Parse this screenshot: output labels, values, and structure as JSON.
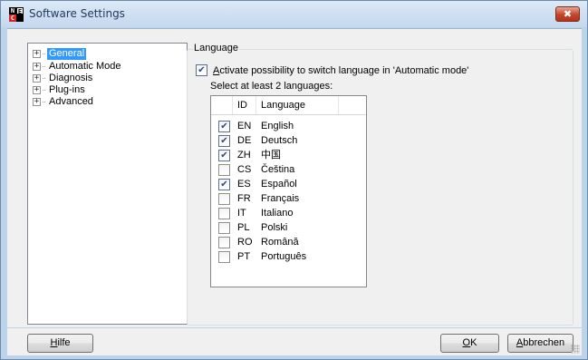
{
  "window": {
    "title": "Software Settings",
    "icon_letters": [
      "N",
      "E",
      "C",
      ""
    ],
    "close_glyph": "✖"
  },
  "tree": {
    "items": [
      {
        "label": "General",
        "selected": true
      },
      {
        "label": "Automatic Mode",
        "selected": false
      },
      {
        "label": "Diagnosis",
        "selected": false
      },
      {
        "label": "Plug-ins",
        "selected": false
      },
      {
        "label": "Advanced",
        "selected": false
      }
    ]
  },
  "language_group": {
    "title": "Language",
    "activate_label_prefix": "A",
    "activate_label_rest": "ctivate possibility to switch language in 'Automatic mode'",
    "activate_checked": true,
    "select_label": "Select at least 2 languages:",
    "columns": [
      "ID",
      "Language"
    ],
    "languages": [
      {
        "id": "EN",
        "name": "English",
        "checked": true
      },
      {
        "id": "DE",
        "name": "Deutsch",
        "checked": true
      },
      {
        "id": "ZH",
        "name": "中国",
        "checked": true
      },
      {
        "id": "CS",
        "name": "Čeština",
        "checked": false
      },
      {
        "id": "ES",
        "name": "Español",
        "checked": true
      },
      {
        "id": "FR",
        "name": "Français",
        "checked": false
      },
      {
        "id": "IT",
        "name": "Italiano",
        "checked": false
      },
      {
        "id": "PL",
        "name": "Polski",
        "checked": false
      },
      {
        "id": "RO",
        "name": "Română",
        "checked": false
      },
      {
        "id": "PT",
        "name": "Português",
        "checked": false
      }
    ]
  },
  "buttons": {
    "help": {
      "mnemonic": "H",
      "rest": "ilfe"
    },
    "ok": {
      "mnemonic": "O",
      "rest": "K"
    },
    "cancel": {
      "mnemonic": "A",
      "rest": "bbrechen"
    }
  },
  "colors": {
    "selection": "#3399ff",
    "titlebar": "#c4d8ee",
    "close_button": "#c4452c"
  }
}
